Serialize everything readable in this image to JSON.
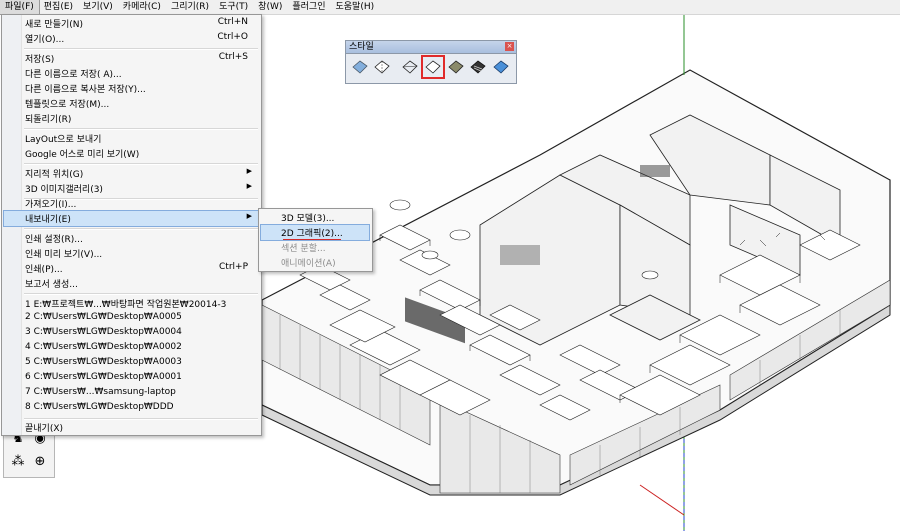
{
  "menubar": {
    "items": [
      {
        "label": "파일(F)"
      },
      {
        "label": "편집(E)"
      },
      {
        "label": "보기(V)"
      },
      {
        "label": "카메라(C)"
      },
      {
        "label": "그리기(R)"
      },
      {
        "label": "도구(T)"
      },
      {
        "label": "창(W)"
      },
      {
        "label": "플러그인"
      },
      {
        "label": "도움말(H)"
      }
    ]
  },
  "file_menu": {
    "items": [
      {
        "label": "새로 만들기(N)",
        "shortcut": "Ctrl+N"
      },
      {
        "label": "열기(O)...",
        "shortcut": "Ctrl+O"
      },
      {
        "label": "저장(S)",
        "shortcut": "Ctrl+S"
      },
      {
        "label": "다른 이름으로 저장( A)...",
        "shortcut": ""
      },
      {
        "label": "다른 이름으로 복사본 저장(Y)...",
        "shortcut": ""
      },
      {
        "label": "템플릿으로 저장(M)...",
        "shortcut": ""
      },
      {
        "label": "되돌리기(R)",
        "shortcut": ""
      },
      {
        "label": "LayOut으로 보내기",
        "shortcut": ""
      },
      {
        "label": "Google 어스로 미리 보기(W)",
        "shortcut": ""
      },
      {
        "label": "지리적 위치(G)",
        "shortcut": ""
      },
      {
        "label": "3D 이미지갤러리(3)",
        "shortcut": ""
      },
      {
        "label": "가져오기(I)...",
        "shortcut": ""
      },
      {
        "label": "내보내기(E)",
        "shortcut": ""
      },
      {
        "label": "인쇄 설정(R)...",
        "shortcut": ""
      },
      {
        "label": "인쇄 미리 보기(V)...",
        "shortcut": ""
      },
      {
        "label": "인쇄(P)...",
        "shortcut": "Ctrl+P"
      },
      {
        "label": "보고서 생성...",
        "shortcut": ""
      },
      {
        "label": "1 E:₩프로젝트₩...₩바탕파면 작업원본₩20014-3",
        "shortcut": ""
      },
      {
        "label": "2 C:₩Users₩LG₩Desktop₩A0005",
        "shortcut": ""
      },
      {
        "label": "3 C:₩Users₩LG₩Desktop₩A0004",
        "shortcut": ""
      },
      {
        "label": "4 C:₩Users₩LG₩Desktop₩A0002",
        "shortcut": ""
      },
      {
        "label": "5 C:₩Users₩LG₩Desktop₩A0003",
        "shortcut": ""
      },
      {
        "label": "6 C:₩Users₩LG₩Desktop₩A0001",
        "shortcut": ""
      },
      {
        "label": "7 C:₩Users₩...₩samsung-laptop",
        "shortcut": ""
      },
      {
        "label": "8 C:₩Users₩LG₩Desktop₩DDD",
        "shortcut": ""
      },
      {
        "label": "끝내기(X)",
        "shortcut": ""
      }
    ]
  },
  "export_submenu": {
    "items": [
      {
        "label": "3D 모델(3)..."
      },
      {
        "label": "2D 그래픽(2)..."
      },
      {
        "label": "섹션 분할..."
      },
      {
        "label": "애니메이션(A)"
      }
    ]
  },
  "style_toolbar": {
    "title": "스타일",
    "buttons": [
      {
        "icon": "xray-style-icon"
      },
      {
        "icon": "back-edges-style-icon"
      },
      {
        "icon": "wireframe-style-icon"
      },
      {
        "icon": "hidden-line-style-icon"
      },
      {
        "icon": "shaded-style-icon"
      },
      {
        "icon": "shaded-textures-style-icon"
      },
      {
        "icon": "monochrome-style-icon"
      }
    ]
  },
  "colors": {
    "highlight": "#cde3f8",
    "highlight_border": "#84acdd",
    "selection_red": "#e02a2a"
  }
}
